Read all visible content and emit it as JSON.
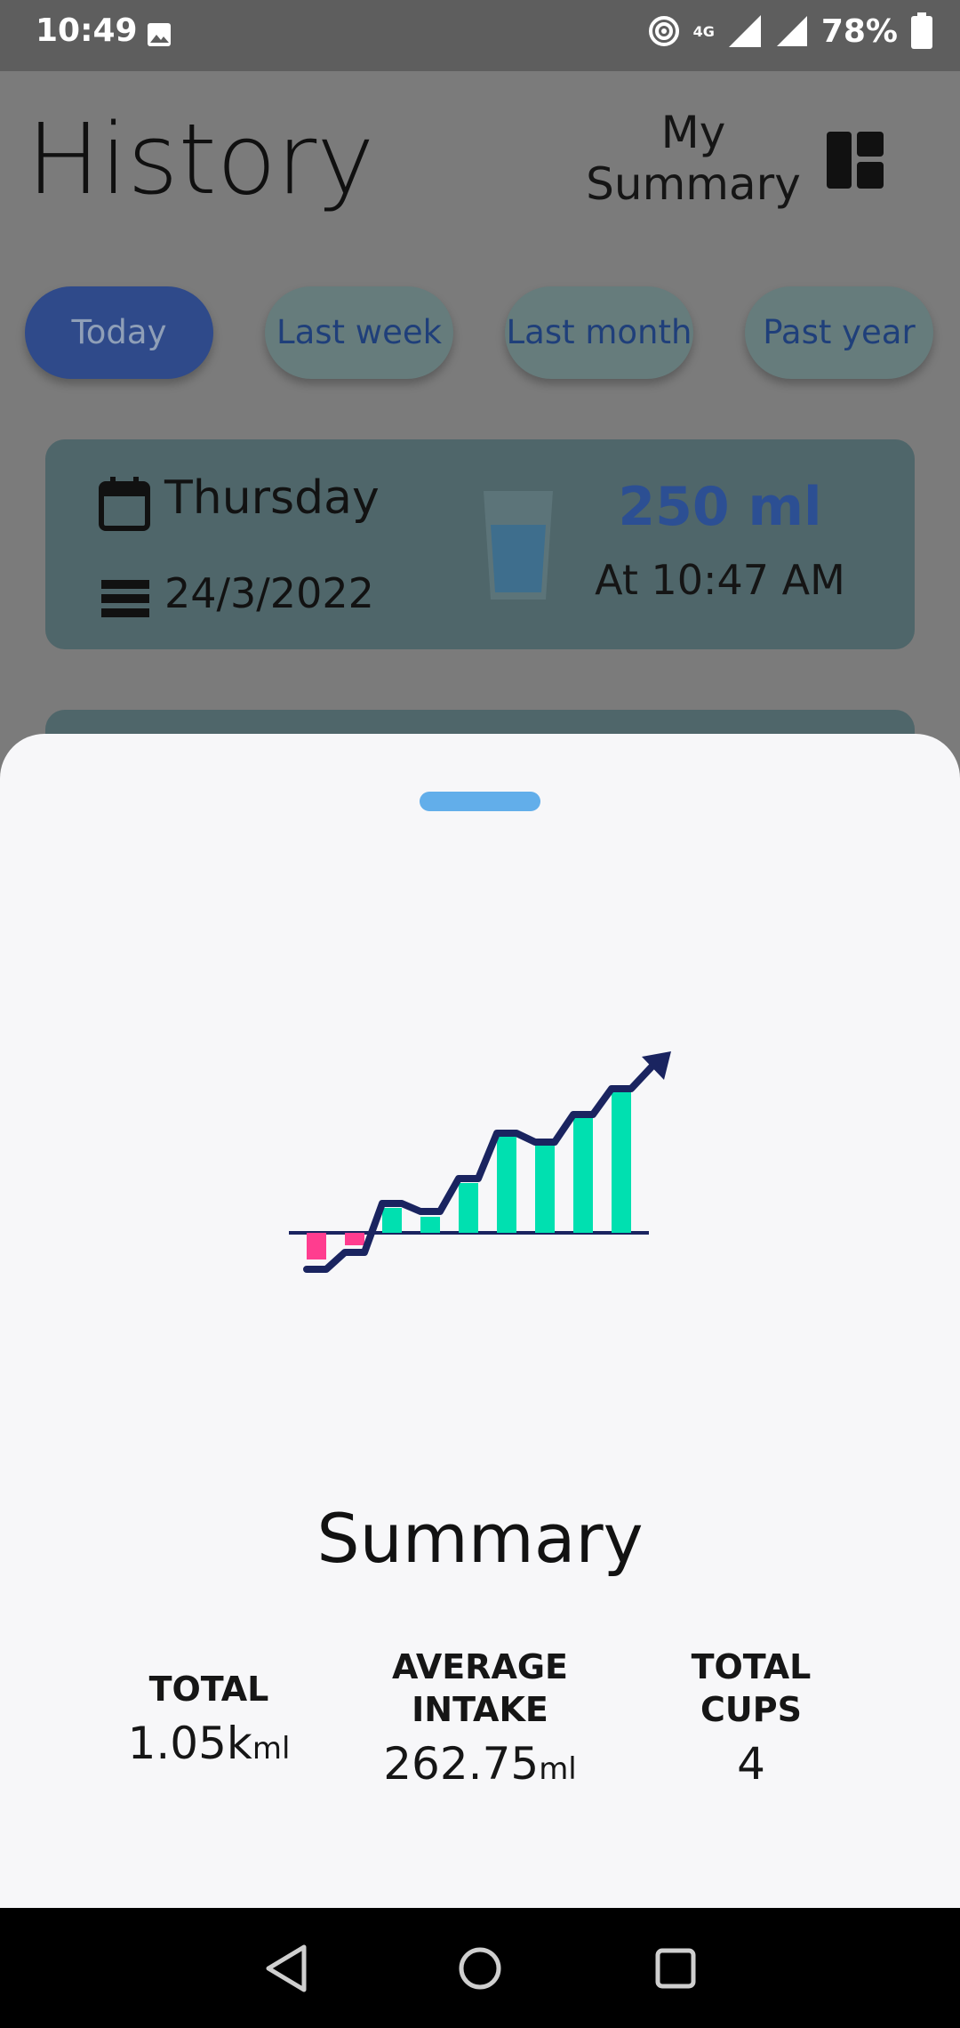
{
  "status_bar": {
    "time": "10:49",
    "network": "4G",
    "battery": "78%"
  },
  "header": {
    "title": "History",
    "summary_link": "My Summary"
  },
  "filters": [
    {
      "label": "Today",
      "active": true
    },
    {
      "label": "Last week",
      "active": false
    },
    {
      "label": "Last month",
      "active": false
    },
    {
      "label": "Past year",
      "active": false
    }
  ],
  "history_card": {
    "day": "Thursday",
    "date": "24/3/2022",
    "amount": "250 ml",
    "time": "At 10:47 AM"
  },
  "sheet": {
    "title": "Summary",
    "stats": [
      {
        "label": "TOTAL",
        "value": "1.05k",
        "unit": "ml"
      },
      {
        "label": "AVERAGE INTAKE",
        "value": "262.75",
        "unit": "ml"
      },
      {
        "label": "TOTAL CUPS",
        "value": "4",
        "unit": ""
      }
    ]
  },
  "colors": {
    "accent_blue": "#62aeea",
    "chart_green": "#00e0b0",
    "chart_pink": "#ff3d8f",
    "chart_line": "#1a2460"
  }
}
